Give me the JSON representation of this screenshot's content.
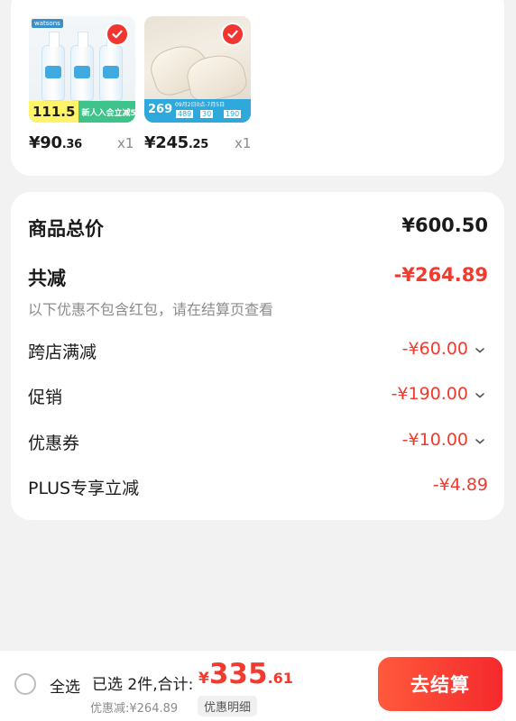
{
  "products": [
    {
      "image": "dove-body-wash-bottles",
      "brand_tag": "watsons",
      "promo_price": "111.5",
      "promo_text": "新人入会立减5元",
      "price_int": "¥90",
      "price_dec": ".36",
      "quantity": "x1",
      "selected": true
    },
    {
      "image": "beige-hollow-sandals",
      "promo_date": "09月2日0点-7月5日",
      "promo_nums": [
        "269",
        "489",
        "30",
        "190"
      ],
      "price_int": "¥245",
      "price_dec": ".25",
      "quantity": "x1",
      "selected": true
    }
  ],
  "summary": {
    "total_label": "商品总价",
    "total_value": "¥600.50",
    "discount_label": "共减",
    "discount_value": "-¥264.89",
    "note": "以下优惠不包含红包，请在结算页查看",
    "items": [
      {
        "label": "跨店满减",
        "value": "-¥60.00",
        "expandable": true
      },
      {
        "label": "促销",
        "value": "-¥190.00",
        "expandable": true
      },
      {
        "label": "优惠券",
        "value": "-¥10.00",
        "expandable": true
      },
      {
        "label": "PLUS专享立减",
        "value": "-¥4.89",
        "expandable": false
      }
    ]
  },
  "bottom": {
    "select_all": "全选",
    "selected_count_text": "已选 2件,合计:",
    "total_symbol": "¥",
    "total_int": "335",
    "total_dec": ".61",
    "discount_text": "优惠减:¥264.89",
    "detail_link": "优惠明细",
    "checkout_label": "去结算"
  },
  "colors": {
    "accent_red": "#f23a2e",
    "check_red": "#f2362f",
    "checkout_gradient": [
      "#ff5a3c",
      "#f5292c"
    ],
    "background": "#f2f2f2"
  }
}
